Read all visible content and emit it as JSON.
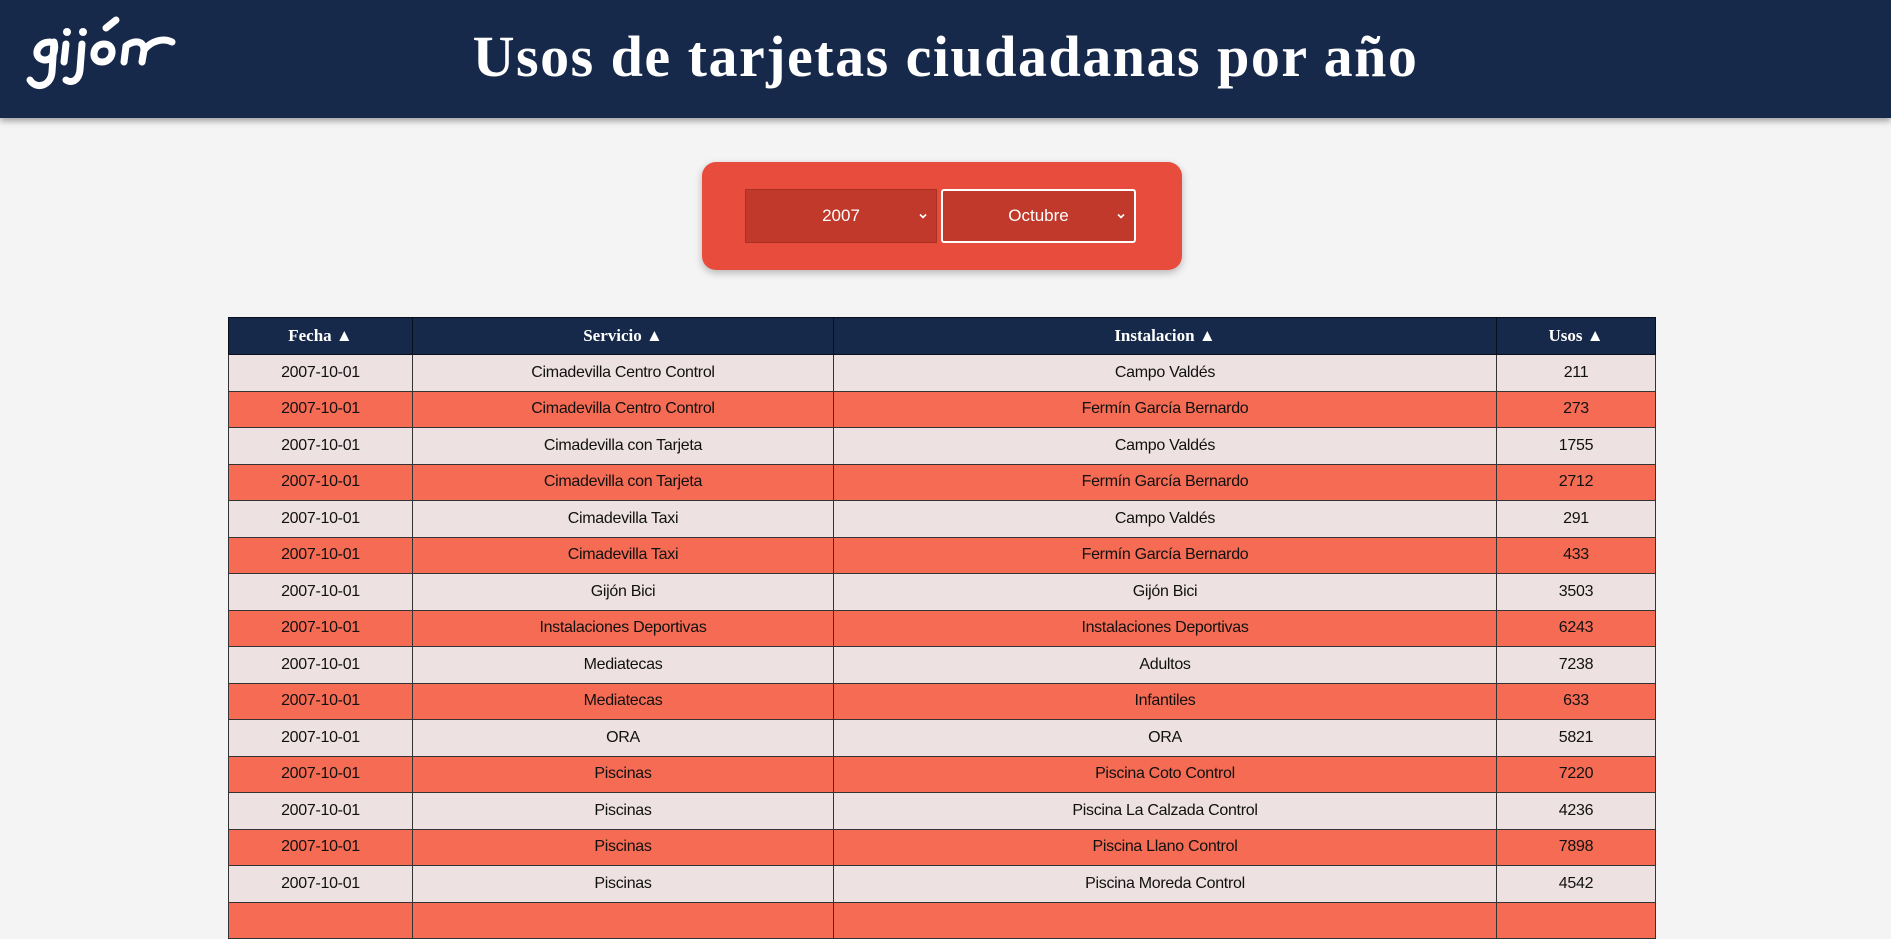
{
  "header": {
    "logo_text": "gijón",
    "title": "Usos de tarjetas ciudadanas por año"
  },
  "filters": {
    "year": "2007",
    "month": "Octubre"
  },
  "table": {
    "columns": [
      "Fecha ▲",
      "Servicio ▲",
      "Instalacion ▲",
      "Usos ▲"
    ],
    "rows": [
      [
        "2007-10-01",
        "Cimadevilla Centro Control",
        "Campo Valdés",
        "211"
      ],
      [
        "2007-10-01",
        "Cimadevilla Centro Control",
        "Fermín García Bernardo",
        "273"
      ],
      [
        "2007-10-01",
        "Cimadevilla con Tarjeta",
        "Campo Valdés",
        "1755"
      ],
      [
        "2007-10-01",
        "Cimadevilla con Tarjeta",
        "Fermín García Bernardo",
        "2712"
      ],
      [
        "2007-10-01",
        "Cimadevilla Taxi",
        "Campo Valdés",
        "291"
      ],
      [
        "2007-10-01",
        "Cimadevilla Taxi",
        "Fermín García Bernardo",
        "433"
      ],
      [
        "2007-10-01",
        "Gijón Bici",
        "Gijón Bici",
        "3503"
      ],
      [
        "2007-10-01",
        "Instalaciones Deportivas",
        "Instalaciones Deportivas",
        "6243"
      ],
      [
        "2007-10-01",
        "Mediatecas",
        "Adultos",
        "7238"
      ],
      [
        "2007-10-01",
        "Mediatecas",
        "Infantiles",
        "633"
      ],
      [
        "2007-10-01",
        "ORA",
        "ORA",
        "5821"
      ],
      [
        "2007-10-01",
        "Piscinas",
        "Piscina Coto Control",
        "7220"
      ],
      [
        "2007-10-01",
        "Piscinas",
        "Piscina La Calzada Control",
        "4236"
      ],
      [
        "2007-10-01",
        "Piscinas",
        "Piscina Llano Control",
        "7898"
      ],
      [
        "2007-10-01",
        "Piscinas",
        "Piscina Moreda Control",
        "4542"
      ],
      [
        "",
        "",
        "",
        ""
      ]
    ]
  },
  "colors": {
    "header_bg": "#17294a",
    "filter_bg": "#e84c3d",
    "select_bg": "#c0392b",
    "row_light": "#ede1e1",
    "row_dark": "#f56b53"
  }
}
